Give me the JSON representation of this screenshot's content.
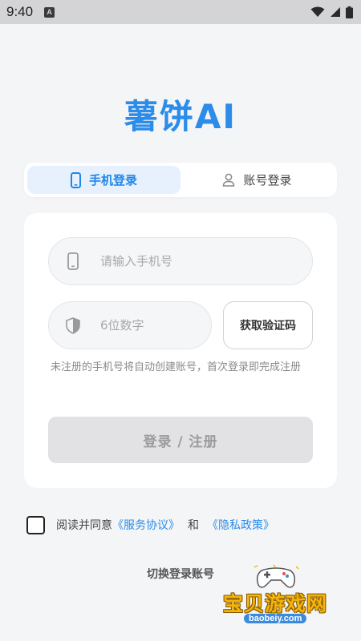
{
  "status_bar": {
    "time": "9:40",
    "badge": "A"
  },
  "app": {
    "title": "薯饼AI"
  },
  "tabs": [
    {
      "label": "手机登录",
      "icon": "phone-icon",
      "active": true
    },
    {
      "label": "账号登录",
      "icon": "person-icon",
      "active": false
    }
  ],
  "form": {
    "phone_placeholder": "请输入手机号",
    "code_placeholder": "6位数字",
    "get_code_label": "获取验证码",
    "hint": "未注册的手机号将自动创建账号，首次登录即完成注册",
    "submit_label": "登录 / 注册"
  },
  "agreement": {
    "prefix": "阅读并同意",
    "service_link": "《服务协议》",
    "and": "和",
    "privacy_link": "《隐私政策》"
  },
  "switch_account": "切换登录账号",
  "watermark": {
    "title": "宝贝游戏网",
    "url": "baobeiy.com"
  },
  "colors": {
    "accent": "#2b8cea",
    "tab_active_bg": "#e6f1fd",
    "button_disabled": "#e2e2e4",
    "background": "#f4f5f7"
  }
}
